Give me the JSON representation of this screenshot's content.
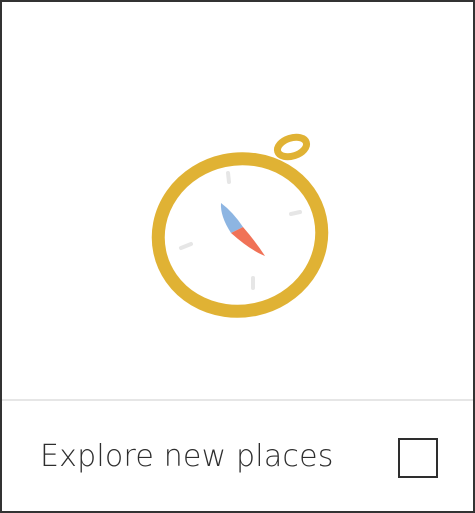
{
  "card": {
    "illustration_icon": "compass-icon",
    "label": "Explore new places",
    "checked": false
  },
  "colors": {
    "compass_ring": "#E0B234",
    "needle_north": "#8DB5E2",
    "needle_south": "#F07257",
    "tick_marks": "#E6E6E6",
    "border": "#333333"
  }
}
